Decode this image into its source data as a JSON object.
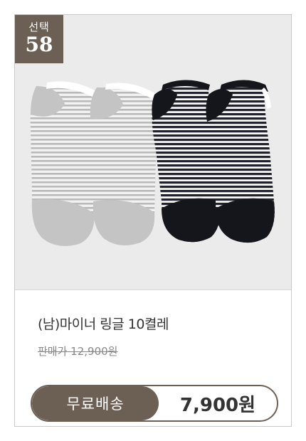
{
  "badge": {
    "label": "선택",
    "number": "58"
  },
  "product": {
    "name": "(남)마이너 링글 10켤레",
    "original_price": "판매가 12,900원",
    "shipping_label": "무료배송",
    "sale_price": "7,900원"
  },
  "colors": {
    "accent": "#6c5f54",
    "photo_bg": "#ebebeb"
  }
}
